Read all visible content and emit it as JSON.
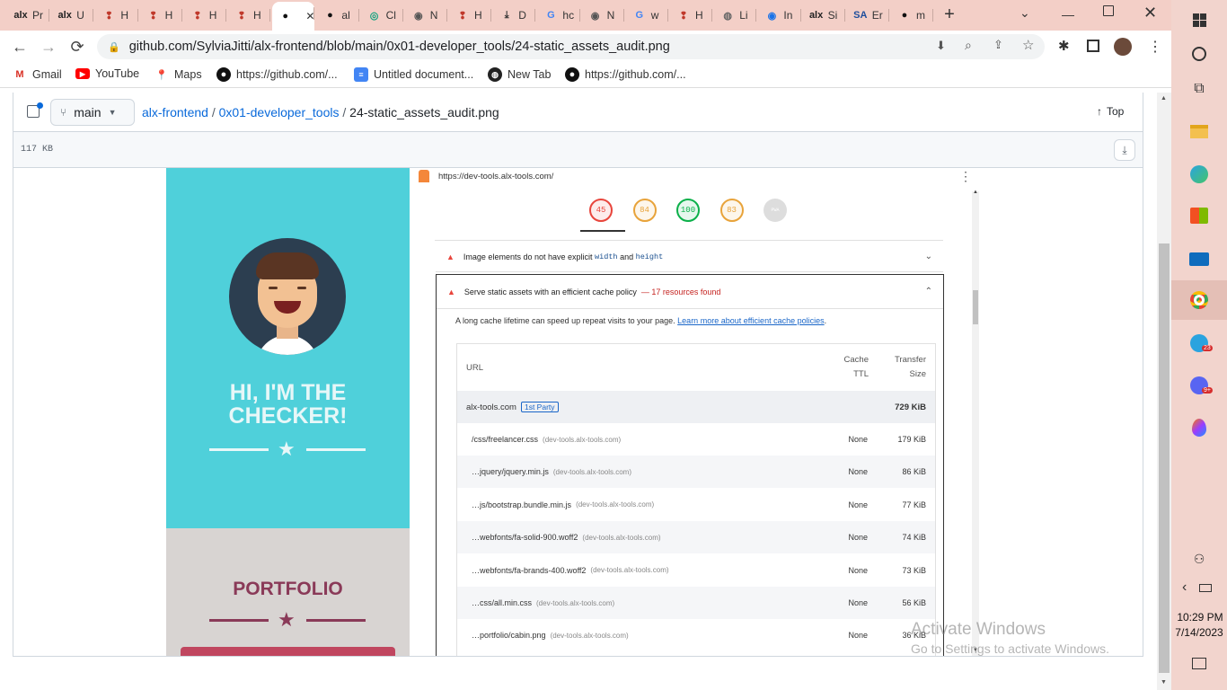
{
  "browser": {
    "tabs": [
      {
        "icon": "alx",
        "label": "Pr"
      },
      {
        "icon": "alx",
        "label": "U"
      },
      {
        "icon": "hbtn",
        "label": "H"
      },
      {
        "icon": "hbtn",
        "label": "H"
      },
      {
        "icon": "hbtn",
        "label": "H"
      },
      {
        "icon": "hbtn",
        "label": "H"
      },
      {
        "icon": "github",
        "label": ""
      },
      {
        "icon": "github",
        "label": "al"
      },
      {
        "icon": "chatgpt",
        "label": "Cl"
      },
      {
        "icon": "chrome-dev",
        "label": "N"
      },
      {
        "icon": "hbtn",
        "label": "H"
      },
      {
        "icon": "download",
        "label": "D"
      },
      {
        "icon": "google",
        "label": "hc"
      },
      {
        "icon": "chrome-dev",
        "label": "N"
      },
      {
        "icon": "google",
        "label": "w"
      },
      {
        "icon": "hbtn",
        "label": "H"
      },
      {
        "icon": "globe",
        "label": "Li"
      },
      {
        "icon": "chrome",
        "label": "In"
      },
      {
        "icon": "alx",
        "label": "Si"
      },
      {
        "icon": "sa",
        "label": "Er"
      },
      {
        "icon": "github",
        "label": "m"
      }
    ],
    "url": "github.com/SylviaJitti/alx-frontend/blob/main/0x01-developer_tools/24-static_assets_audit.png",
    "bookmarks": [
      {
        "icon": "gmail",
        "label": "Gmail"
      },
      {
        "icon": "youtube",
        "label": "YouTube"
      },
      {
        "icon": "maps",
        "label": "Maps"
      },
      {
        "icon": "github",
        "label": "https://github.com/..."
      },
      {
        "icon": "docs",
        "label": "Untitled document..."
      },
      {
        "icon": "newtab",
        "label": "New Tab"
      },
      {
        "icon": "github",
        "label": "https://github.com/..."
      }
    ]
  },
  "github": {
    "branch": "main",
    "breadcrumb": [
      "alx-frontend",
      "0x01-developer_tools",
      "24-static_assets_audit.png"
    ],
    "top_label": "Top",
    "file_size": "117 KB"
  },
  "portfolio": {
    "greeting": "HI, I'M THE CHECKER!",
    "section": "PORTFOLIO"
  },
  "devtools": {
    "url": "https://dev-tools.alx-tools.com/",
    "scores": [
      {
        "value": "45",
        "color": "#e8453c"
      },
      {
        "value": "84",
        "color": "#e8a33a"
      },
      {
        "value": "100",
        "color": "#0cb04a"
      },
      {
        "value": "83",
        "color": "#e8a33a"
      },
      {
        "value": "PWA",
        "color": "#aaaaaa"
      }
    ],
    "audit_image_prefix": "Image elements do not have explicit",
    "audit_image_code1": "width",
    "audit_image_and": "and",
    "audit_image_code2": "height",
    "audit_cache_title": "Serve static assets with an efficient cache policy",
    "audit_cache_found": "— 17 resources found",
    "audit_cache_desc": "A long cache lifetime can speed up repeat visits to your page.",
    "audit_cache_link": "Learn more about efficient cache policies",
    "col_url": "URL",
    "col_ttl_1": "Cache",
    "col_ttl_2": "TTL",
    "col_size_1": "Transfer",
    "col_size_2": "Size",
    "group_host": "alx-tools.com",
    "group_badge": "1st Party",
    "group_size": "729 KiB",
    "rows": [
      {
        "path": "/css/freelancer.css",
        "host": "(dev-tools.alx-tools.com)",
        "ttl": "None",
        "size": "179 KiB"
      },
      {
        "path": "…jquery/jquery.min.js",
        "host": "(dev-tools.alx-tools.com)",
        "ttl": "None",
        "size": "86 KiB"
      },
      {
        "path": "…js/bootstrap.bundle.min.js",
        "host": "(dev-tools.alx-tools.com)",
        "ttl": "None",
        "size": "77 KiB"
      },
      {
        "path": "…webfonts/fa-solid-900.woff2",
        "host": "(dev-tools.alx-tools.com)",
        "ttl": "None",
        "size": "74 KiB"
      },
      {
        "path": "…webfonts/fa-brands-400.woff2",
        "host": "(dev-tools.alx-tools.com)",
        "ttl": "None",
        "size": "73 KiB"
      },
      {
        "path": "…css/all.min.css",
        "host": "(dev-tools.alx-tools.com)",
        "ttl": "None",
        "size": "56 KiB"
      },
      {
        "path": "…portfolio/cabin.png",
        "host": "(dev-tools.alx-tools.com)",
        "ttl": "None",
        "size": "36 KiB"
      }
    ]
  },
  "watermark": {
    "line1": "Activate Windows",
    "line2": "Go to Settings to activate Windows."
  },
  "taskbar": {
    "time": "10:29 PM",
    "date": "7/14/2023",
    "telegram_badge": "23",
    "discord_badge": "9+"
  }
}
